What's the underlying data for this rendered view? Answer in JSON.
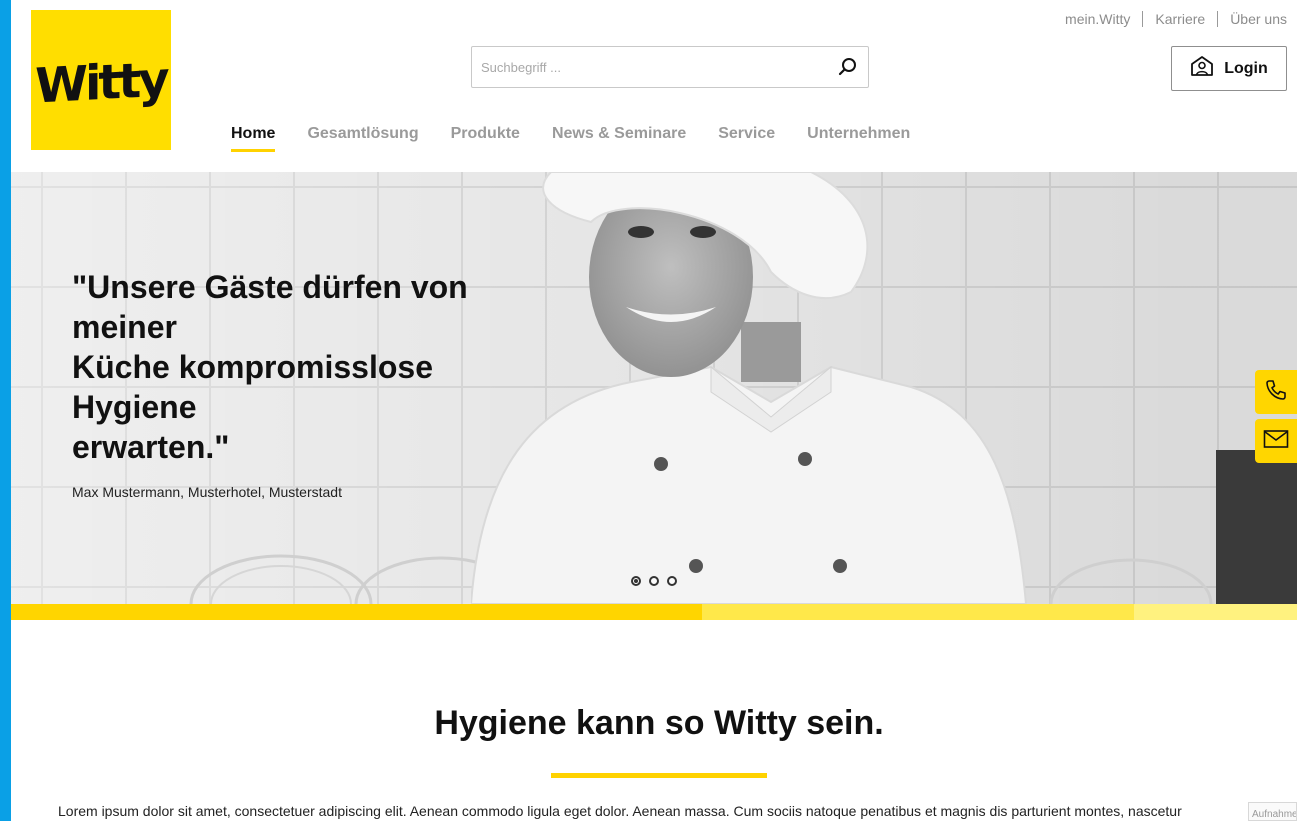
{
  "brand": {
    "logo_text": "Witty",
    "color": "#ffde00"
  },
  "top_links": [
    "mein.Witty",
    "Karriere",
    "Über uns"
  ],
  "search": {
    "placeholder": "Suchbegriff ...",
    "value": ""
  },
  "login": {
    "label": "Login"
  },
  "nav": [
    {
      "label": "Home",
      "active": true
    },
    {
      "label": "Gesamtlösung",
      "active": false
    },
    {
      "label": "Produkte",
      "active": false
    },
    {
      "label": "News & Seminare",
      "active": false
    },
    {
      "label": "Service",
      "active": false
    },
    {
      "label": "Unternehmen",
      "active": false
    }
  ],
  "hero": {
    "quote_lines": [
      "\"Unsere Gäste dürfen von",
      "meiner",
      "Küche kompromisslose",
      "Hygiene",
      "erwarten.\""
    ],
    "author": "Max Mustermann, Musterhotel, Musterstadt",
    "slides": 3,
    "active_slide": 1
  },
  "color_bars": [
    "#ffd500",
    "#ffe84a",
    "#fff27f"
  ],
  "side_actions": [
    "phone-icon",
    "mail-icon"
  ],
  "section": {
    "headline": "Hygiene kann so Witty sein.",
    "body": "Lorem ipsum dolor sit amet, consectetuer adipiscing elit. Aenean commodo ligula eget dolor. Aenean massa. Cum sociis natoque penatibus et magnis dis parturient montes, nascetur"
  },
  "corner_label": "Aufnahme"
}
